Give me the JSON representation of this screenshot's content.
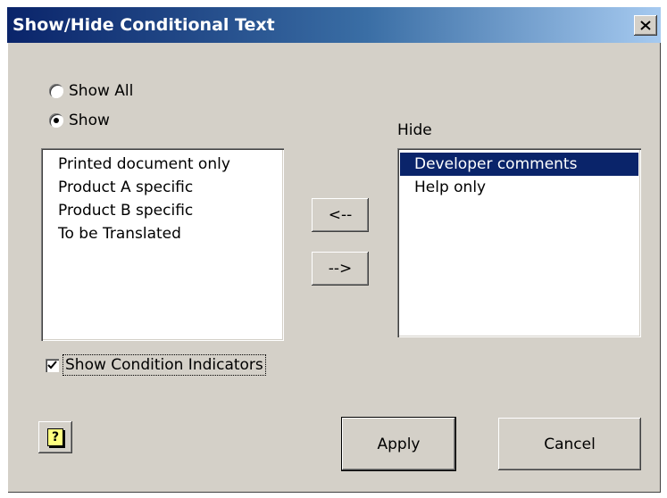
{
  "window": {
    "title": "Show/Hide Conditional Text",
    "close_icon": "close-icon"
  },
  "visibility": {
    "show_all_label": "Show All",
    "show_label": "Show",
    "selected": "Show"
  },
  "show_list": {
    "items": [
      "Printed document only",
      "Product A specific",
      "Product B specific",
      "To be Translated"
    ]
  },
  "hide_list": {
    "label": "Hide",
    "items": [
      "Developer comments",
      "Help only"
    ],
    "selected_index": 0
  },
  "move_buttons": {
    "move_left_label": "<--",
    "move_right_label": "-->"
  },
  "indicators": {
    "label": "Show Condition Indicators",
    "checked": true
  },
  "footer": {
    "help_icon": "help-icon",
    "help_glyph": "?",
    "apply_label": "Apply",
    "cancel_label": "Cancel"
  },
  "colors": {
    "title_bar_start": "#0a246a",
    "title_bar_end": "#a6caf0",
    "dialog_face": "#d4d0c8",
    "selection": "#0a246a"
  }
}
